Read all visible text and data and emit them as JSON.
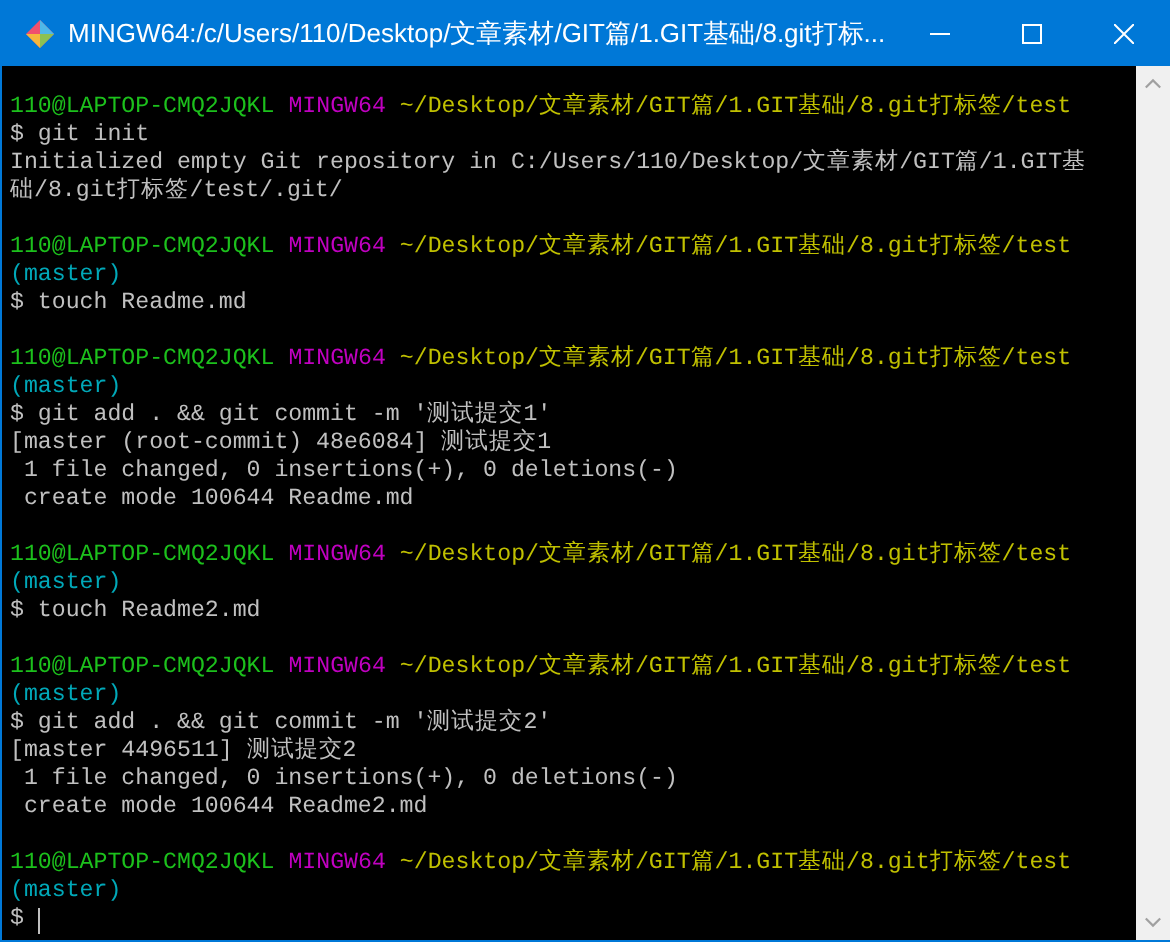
{
  "window": {
    "title": "MINGW64:/c/Users/110/Desktop/文章素材/GIT篇/1.GIT基础/8.git打标..."
  },
  "lines": [
    {
      "kind": "prompt",
      "user": "110@LAPTOP-CMQ2JQKL",
      "system": "MINGW64",
      "path": "~/Desktop/文章素材/GIT篇/1.GIT基础/8.git打标签/test"
    },
    {
      "kind": "command",
      "text": "$ git init"
    },
    {
      "kind": "output",
      "text": "Initialized empty Git repository in C:/Users/110/Desktop/文章素材/GIT篇/1.GIT基"
    },
    {
      "kind": "output",
      "text": "础/8.git打标签/test/.git/"
    },
    {
      "kind": "blank"
    },
    {
      "kind": "prompt",
      "user": "110@LAPTOP-CMQ2JQKL",
      "system": "MINGW64",
      "path": "~/Desktop/文章素材/GIT篇/1.GIT基础/8.git打标签/test"
    },
    {
      "kind": "branch",
      "text": "(master)"
    },
    {
      "kind": "command",
      "text": "$ touch Readme.md"
    },
    {
      "kind": "blank"
    },
    {
      "kind": "prompt",
      "user": "110@LAPTOP-CMQ2JQKL",
      "system": "MINGW64",
      "path": "~/Desktop/文章素材/GIT篇/1.GIT基础/8.git打标签/test"
    },
    {
      "kind": "branch",
      "text": "(master)"
    },
    {
      "kind": "command",
      "text": "$ git add . && git commit -m '测试提交1'"
    },
    {
      "kind": "output",
      "text": "[master (root-commit) 48e6084] 测试提交1"
    },
    {
      "kind": "output",
      "text": " 1 file changed, 0 insertions(+), 0 deletions(-)"
    },
    {
      "kind": "output",
      "text": " create mode 100644 Readme.md"
    },
    {
      "kind": "blank"
    },
    {
      "kind": "prompt",
      "user": "110@LAPTOP-CMQ2JQKL",
      "system": "MINGW64",
      "path": "~/Desktop/文章素材/GIT篇/1.GIT基础/8.git打标签/test"
    },
    {
      "kind": "branch",
      "text": "(master)"
    },
    {
      "kind": "command",
      "text": "$ touch Readme2.md"
    },
    {
      "kind": "blank"
    },
    {
      "kind": "prompt",
      "user": "110@LAPTOP-CMQ2JQKL",
      "system": "MINGW64",
      "path": "~/Desktop/文章素材/GIT篇/1.GIT基础/8.git打标签/test"
    },
    {
      "kind": "branch",
      "text": "(master)"
    },
    {
      "kind": "command",
      "text": "$ git add . && git commit -m '测试提交2'"
    },
    {
      "kind": "output",
      "text": "[master 4496511] 测试提交2"
    },
    {
      "kind": "output",
      "text": " 1 file changed, 0 insertions(+), 0 deletions(-)"
    },
    {
      "kind": "output",
      "text": " create mode 100644 Readme2.md"
    },
    {
      "kind": "blank"
    },
    {
      "kind": "prompt",
      "user": "110@LAPTOP-CMQ2JQKL",
      "system": "MINGW64",
      "path": "~/Desktop/文章素材/GIT篇/1.GIT基础/8.git打标签/test"
    },
    {
      "kind": "branch",
      "text": "(master)"
    },
    {
      "kind": "input",
      "text": "$",
      "cursor": true
    }
  ]
}
